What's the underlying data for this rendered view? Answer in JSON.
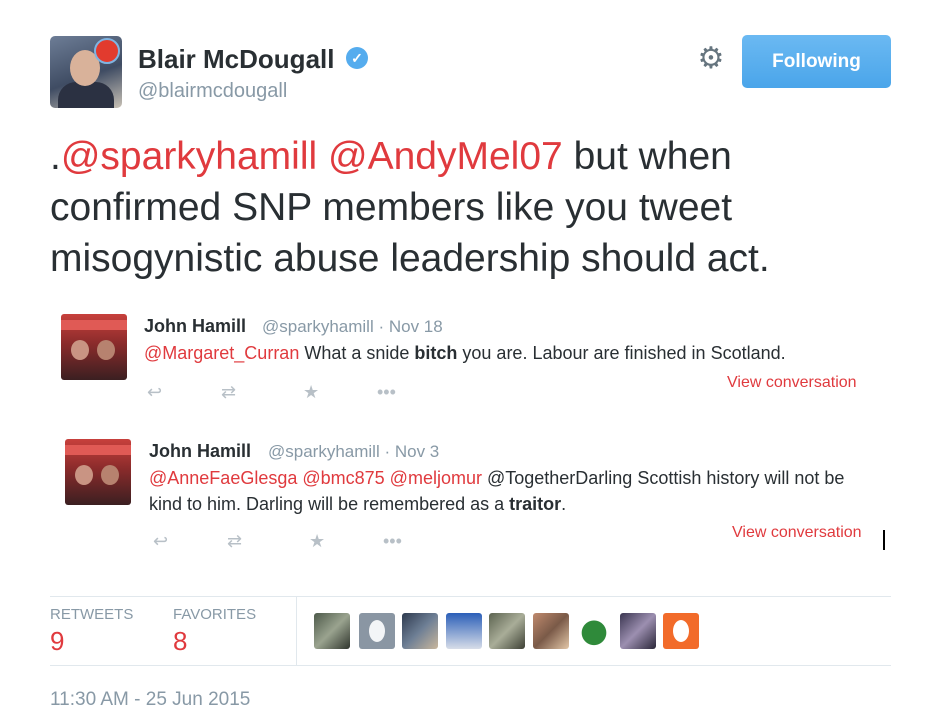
{
  "author": {
    "name": "Blair McDougall",
    "handle": "@blairmcdougall",
    "verified_icon": "verified-badge-icon"
  },
  "follow_button_label": "Following",
  "tweet": {
    "prefix": ".",
    "mention1": "@sparkyhamill",
    "space": " ",
    "mention2": "@AndyMel07",
    "rest": " but when confirmed SNP members like you tweet misogynistic abuse leadership should act."
  },
  "embedded_tweets": [
    {
      "name": "John Hamill",
      "meta": "@sparkyhamill · Nov 18",
      "mentions": "@Margaret_Curran",
      "text_before": " What a snide ",
      "bold": "bitch",
      "text_after": " you are. Labour are finished in Scotland.",
      "view_conversation": "View conversation"
    },
    {
      "name": "John Hamill",
      "meta": "@sparkyhamill · Nov 3",
      "mentions": "@AnneFaeGlesga @bmc875 @meljomur",
      "text_before": " @TogetherDarling Scottish history will not be kind to him. Darling will be remembered as a ",
      "bold": "traitor",
      "text_after": ".",
      "view_conversation": "View conversation"
    }
  ],
  "stats": {
    "retweets_label": "RETWEETS",
    "retweets_value": "9",
    "favorites_label": "FAVORITES",
    "favorites_value": "8"
  },
  "timestamp": "11:30 AM - 25 Jun 2015",
  "colors": {
    "accent": "#e03a3e",
    "button": "#55acee",
    "muted": "#8899a6"
  }
}
